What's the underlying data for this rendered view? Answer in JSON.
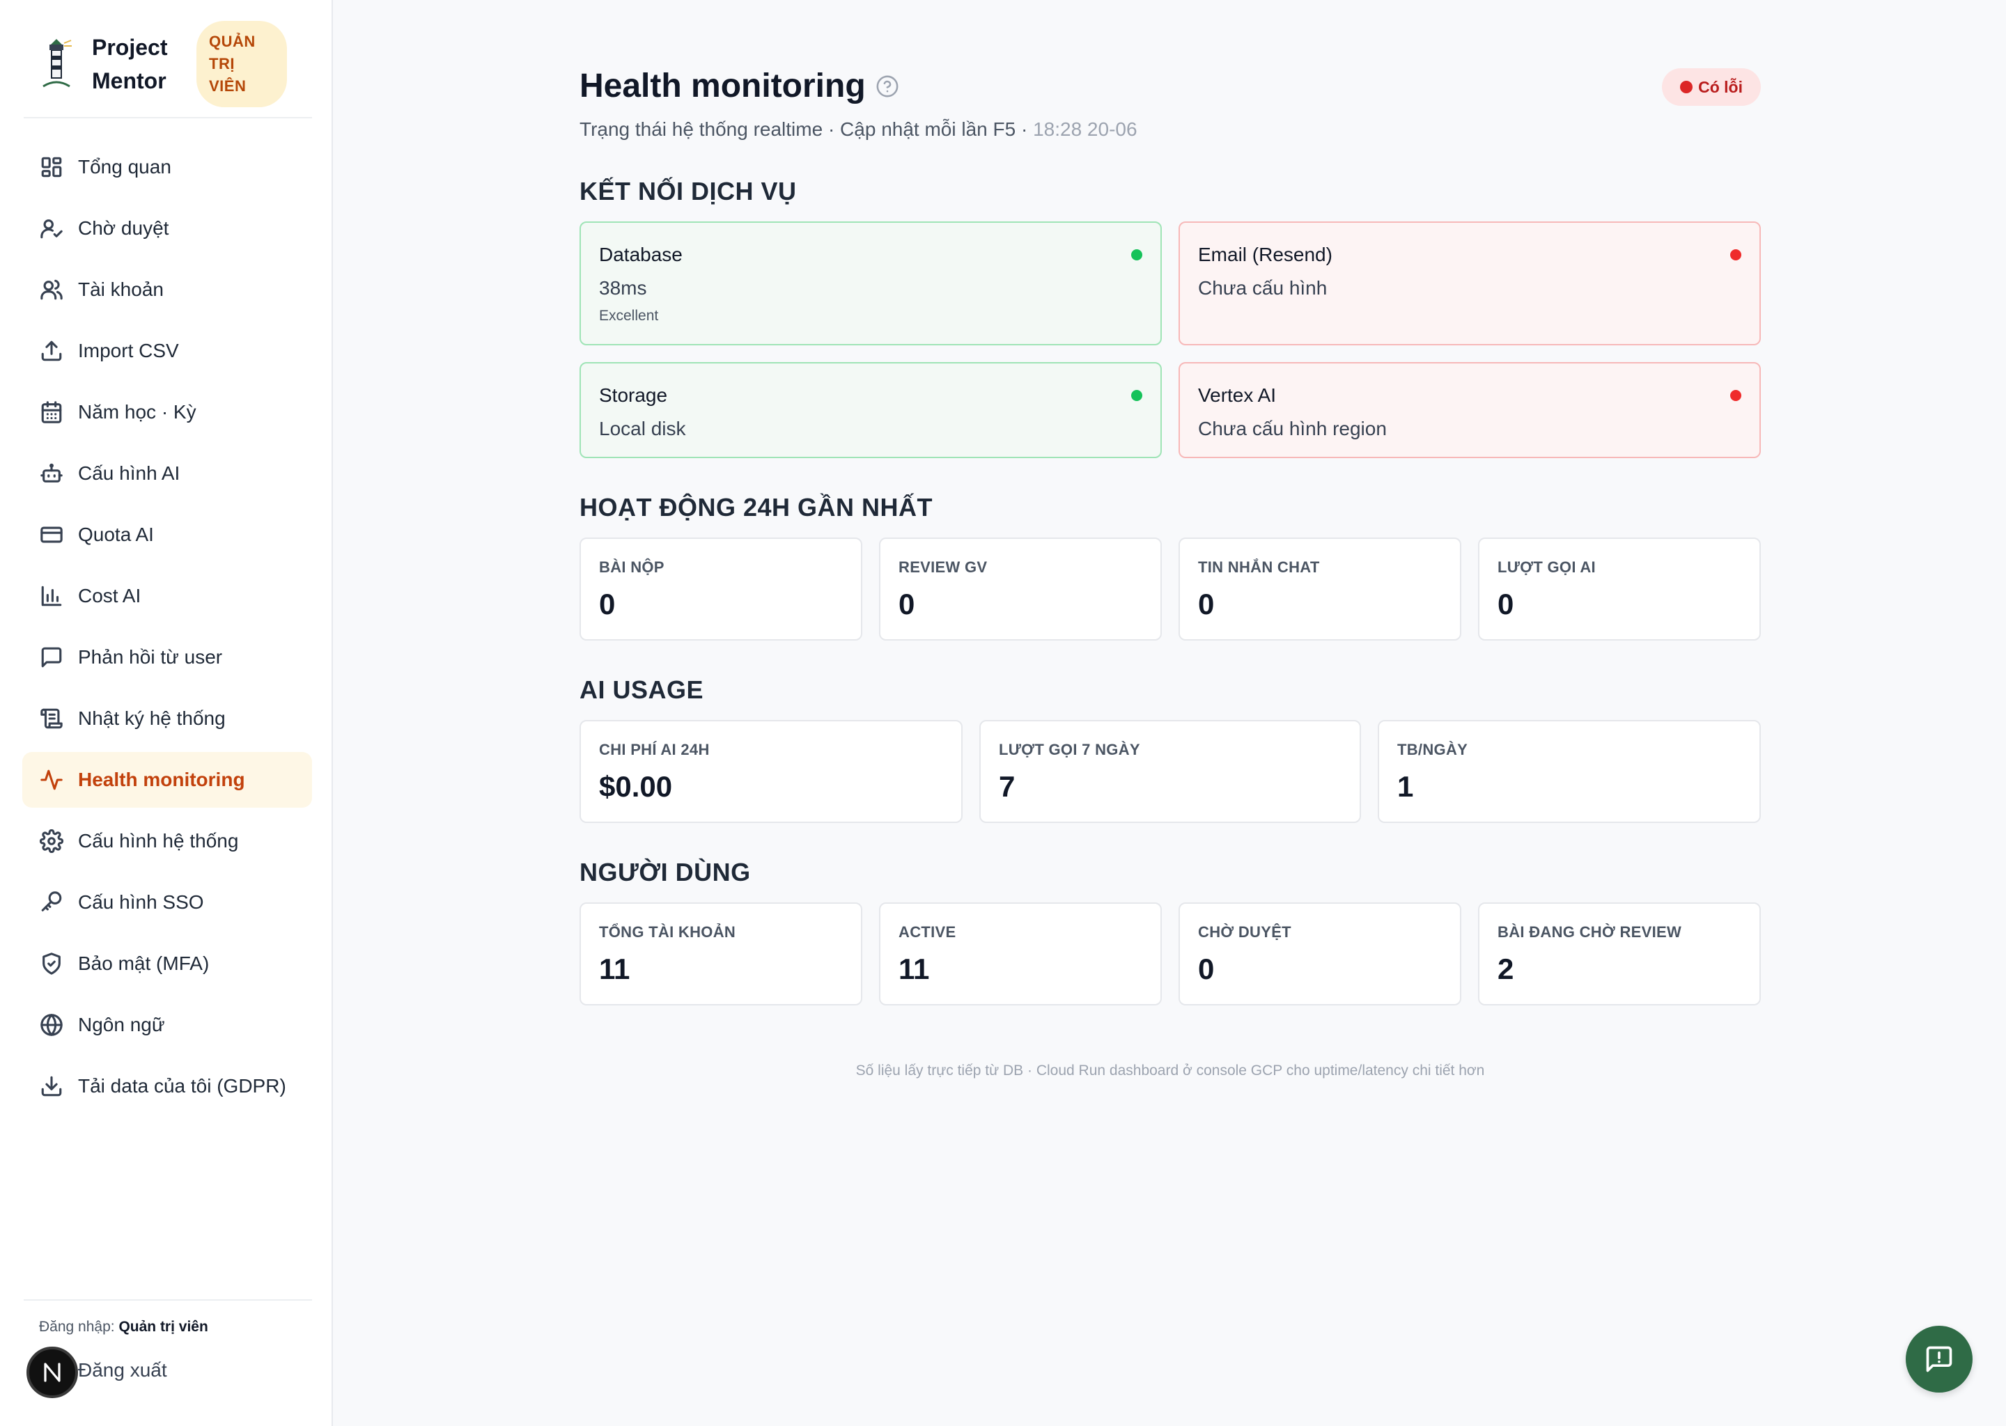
{
  "brand": {
    "name": "Project Mentor",
    "role_badge": "QUẢN TRỊ VIÊN"
  },
  "sidebar": {
    "items": [
      {
        "label": "Tổng quan",
        "icon": "dashboard-grid-icon"
      },
      {
        "label": "Chờ duyệt",
        "icon": "user-check-icon"
      },
      {
        "label": "Tài khoản",
        "icon": "users-icon"
      },
      {
        "label": "Import CSV",
        "icon": "upload-icon"
      },
      {
        "label": "Năm học · Kỳ",
        "icon": "calendar-icon"
      },
      {
        "label": "Cấu hình AI",
        "icon": "robot-icon"
      },
      {
        "label": "Quota AI",
        "icon": "credit-card-icon"
      },
      {
        "label": "Cost AI",
        "icon": "bar-chart-icon"
      },
      {
        "label": "Phản hồi từ user",
        "icon": "message-square-icon"
      },
      {
        "label": "Nhật ký hệ thống",
        "icon": "scroll-icon"
      },
      {
        "label": "Health monitoring",
        "icon": "activity-icon",
        "active": true
      },
      {
        "label": "Cấu hình hệ thống",
        "icon": "gear-icon"
      },
      {
        "label": "Cấu hình SSO",
        "icon": "key-icon"
      },
      {
        "label": "Bảo mật (MFA)",
        "icon": "shield-check-icon"
      },
      {
        "label": "Ngôn ngữ",
        "icon": "globe-icon"
      },
      {
        "label": "Tải data của tôi (GDPR)",
        "icon": "download-icon"
      }
    ],
    "login_prefix": "Đăng nhập:",
    "login_user": "Quản trị viên",
    "logout": "Đăng xuất",
    "n_badge": "N"
  },
  "header": {
    "title": "Health monitoring",
    "subtitle": "Trạng thái hệ thống realtime · Cập nhật mỗi lần F5 ·",
    "updated_time": "18:28 20-06",
    "status": "Có lỗi"
  },
  "services": {
    "title": "KẾT NỐI DỊCH VỤ",
    "items": [
      {
        "name": "Database",
        "value": "38ms",
        "note": "Excellent",
        "status": "ok"
      },
      {
        "name": "Email (Resend)",
        "value": "Chưa cấu hình",
        "status": "error"
      },
      {
        "name": "Storage",
        "value": "Local disk",
        "status": "ok"
      },
      {
        "name": "Vertex AI",
        "value": "Chưa cấu hình region",
        "status": "error"
      }
    ]
  },
  "activity": {
    "title": "HOẠT ĐỘNG 24H GẦN NHẤT",
    "stats": [
      {
        "label": "BÀI NỘP",
        "value": "0"
      },
      {
        "label": "REVIEW GV",
        "value": "0"
      },
      {
        "label": "TIN NHẮN CHAT",
        "value": "0"
      },
      {
        "label": "LƯỢT GỌI AI",
        "value": "0"
      }
    ]
  },
  "ai_usage": {
    "title": "AI USAGE",
    "stats": [
      {
        "label": "CHI PHÍ AI 24H",
        "value": "$0.00"
      },
      {
        "label": "LƯỢT GỌI 7 NGÀY",
        "value": "7"
      },
      {
        "label": "TB/NGÀY",
        "value": "1"
      }
    ]
  },
  "users": {
    "title": "NGƯỜI DÙNG",
    "stats": [
      {
        "label": "TỔNG TÀI KHOẢN",
        "value": "11"
      },
      {
        "label": "ACTIVE",
        "value": "11"
      },
      {
        "label": "CHỜ DUYỆT",
        "value": "0"
      },
      {
        "label": "BÀI ĐANG CHỜ REVIEW",
        "value": "2"
      }
    ]
  },
  "footnote": "Số liệu lấy trực tiếp từ DB · Cloud Run dashboard ở console GCP cho uptime/latency chi tiết hơn",
  "colors": {
    "accent": "#c2410c",
    "ok": "#16c25a",
    "error": "#ef2b2b",
    "fab": "#2f6b46"
  }
}
